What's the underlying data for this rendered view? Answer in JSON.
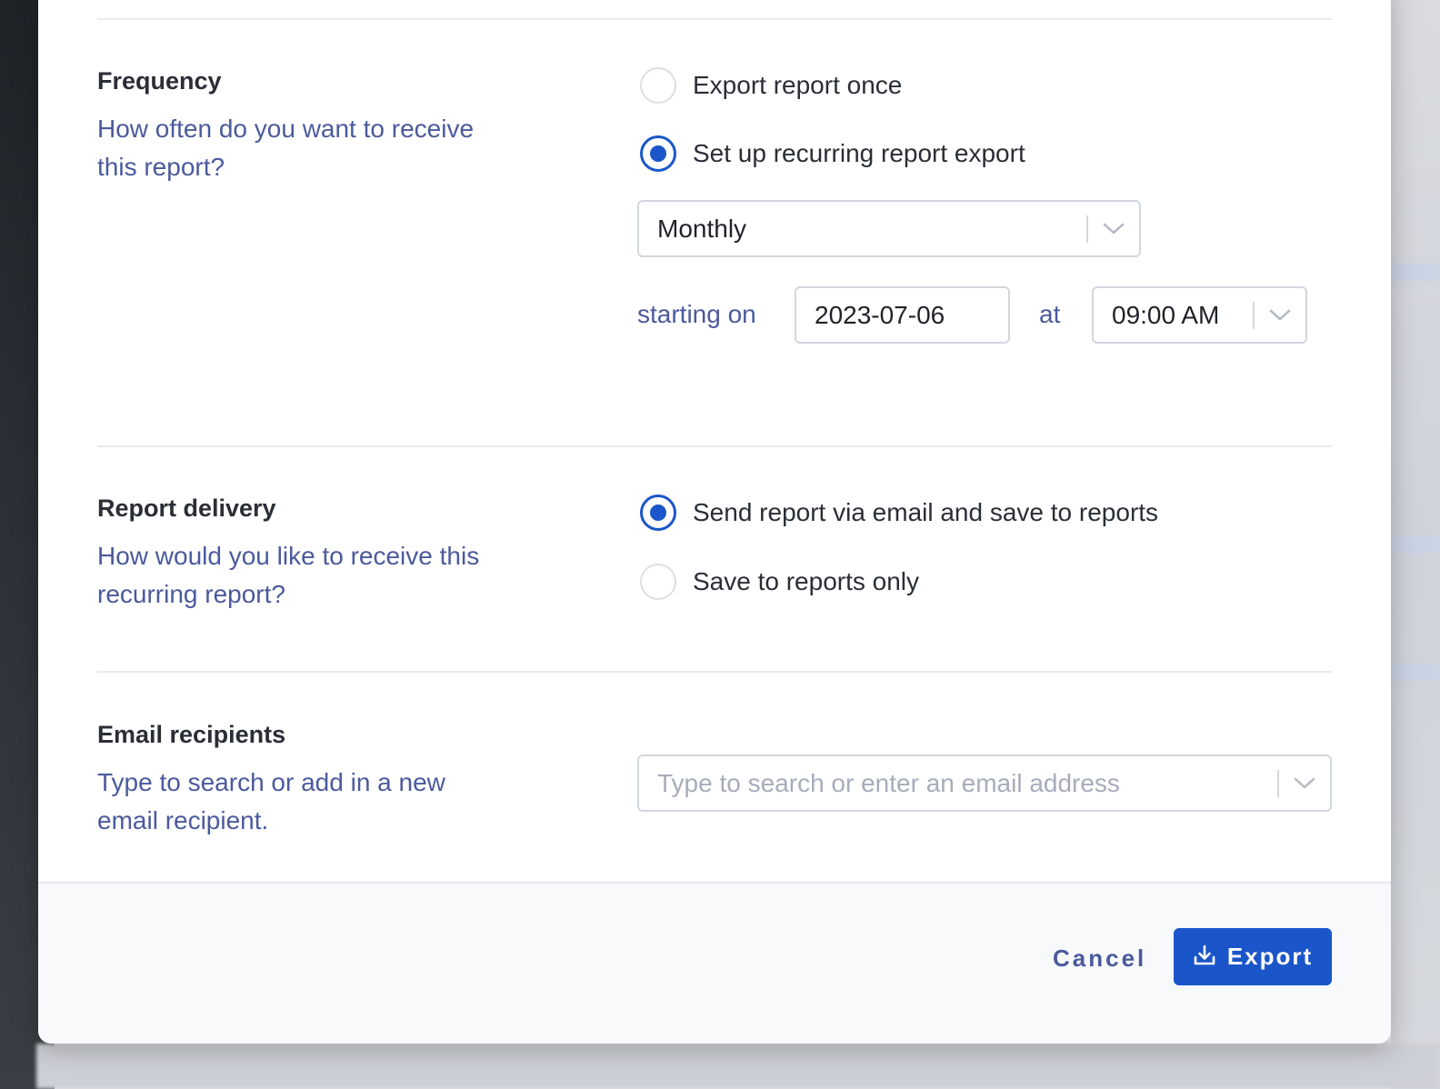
{
  "frequency": {
    "title": "Frequency",
    "description": "How often do you want to receive this report?",
    "options": [
      {
        "label": "Export report once",
        "checked": false
      },
      {
        "label": "Set up recurring report export",
        "checked": true
      }
    ],
    "interval": {
      "value": "Monthly"
    },
    "starting_label": "starting on",
    "start_date": "2023-07-06",
    "at_label": "at",
    "time": {
      "value": "09:00 AM"
    }
  },
  "delivery": {
    "title": "Report delivery",
    "description": "How would you like to receive this recurring report?",
    "options": [
      {
        "label": "Send report via email and save to reports",
        "checked": true
      },
      {
        "label": "Save to reports only",
        "checked": false
      }
    ]
  },
  "recipients": {
    "title": "Email recipients",
    "description": "Type to search or add in a new email recipient.",
    "placeholder": "Type to search or enter an email address"
  },
  "footer": {
    "cancel_label": "Cancel",
    "export_label": "Export"
  },
  "colors": {
    "accent": "#1a56c9",
    "description_text": "#4b5a9c",
    "border": "#d2d6de"
  },
  "icons": {
    "chevron": "chevron-down-icon",
    "export": "download-icon"
  }
}
